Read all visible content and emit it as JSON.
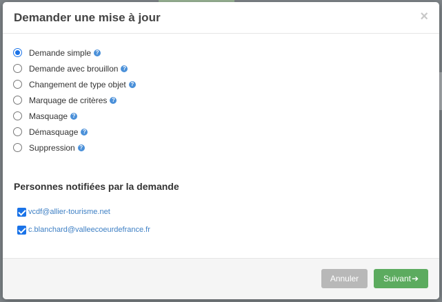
{
  "modal": {
    "title": "Demander une mise à jour",
    "close_label": "×"
  },
  "options": [
    {
      "label": "Demande simple",
      "checked": true
    },
    {
      "label": "Demande avec brouillon",
      "checked": false
    },
    {
      "label": "Changement de type objet",
      "checked": false
    },
    {
      "label": "Marquage de critères",
      "checked": false
    },
    {
      "label": "Masquage",
      "checked": false
    },
    {
      "label": "Démasquage",
      "checked": false
    },
    {
      "label": "Suppression",
      "checked": false
    }
  ],
  "help_glyph": "?",
  "notified": {
    "title": "Personnes notifiées par la demande",
    "emails": [
      {
        "email": "vcdf@allier-tourisme.net",
        "checked": true
      },
      {
        "email": "c.blanchard@valleecoeurdefrance.fr",
        "checked": true
      }
    ]
  },
  "footer": {
    "cancel_label": "Annuler",
    "next_label": "Suivant",
    "next_icon": "arrow-right-icon"
  },
  "colors": {
    "primary": "#1a73e8",
    "success": "#5cab5f",
    "muted": "#b8b8b8",
    "help": "#4a90d9"
  }
}
